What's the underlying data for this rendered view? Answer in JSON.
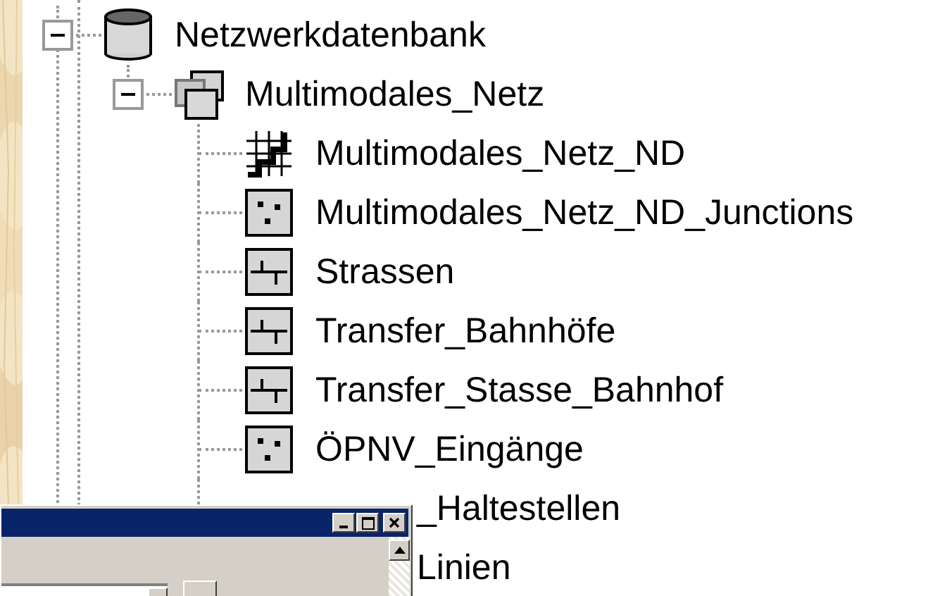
{
  "tree": [
    {
      "label": "Netzwerkdatenbank",
      "kind": "database",
      "expanded": true,
      "children": [
        {
          "label": "Multimodales_Netz",
          "kind": "dataset",
          "expanded": true,
          "children": [
            {
              "label": "Multimodales_Netz_ND",
              "kind": "network"
            },
            {
              "label": "Multimodales_Netz_ND_Junctions",
              "kind": "points"
            },
            {
              "label": "Strassen",
              "kind": "lines"
            },
            {
              "label": "Transfer_Bahnhöfe",
              "kind": "lines"
            },
            {
              "label": "Transfer_Stasse_Bahnhof",
              "kind": "lines"
            },
            {
              "label": "ÖPNV_Eingänge",
              "kind": "points"
            },
            {
              "label": "_Haltestellen",
              "kind": "covered"
            },
            {
              "label": "Linien",
              "kind": "covered"
            }
          ]
        }
      ]
    }
  ]
}
